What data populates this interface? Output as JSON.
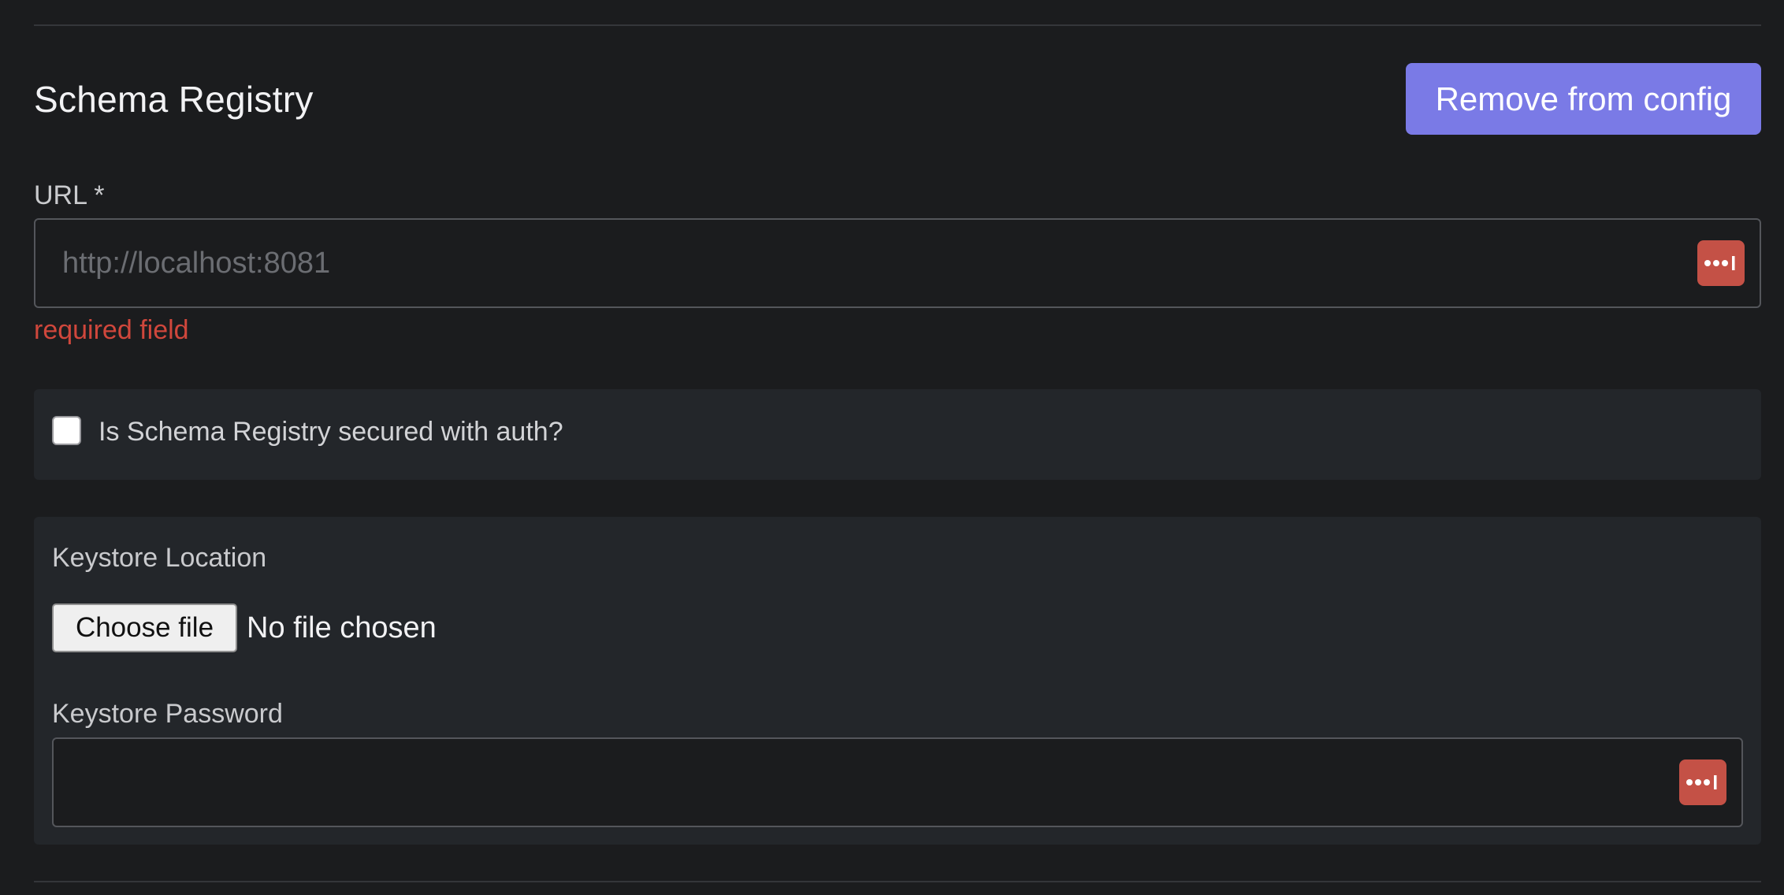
{
  "section": {
    "title": "Schema Registry",
    "remove_button_label": "Remove from config"
  },
  "url_field": {
    "label": "URL *",
    "value": "",
    "placeholder": "http://localhost:8081",
    "error": "required field",
    "icon": "password-manager-icon"
  },
  "auth": {
    "checkbox_label": "Is Schema Registry secured with auth?",
    "checked": false
  },
  "keystore": {
    "location_label": "Keystore Location",
    "choose_file_label": "Choose file",
    "file_status": "No file chosen",
    "password_label": "Keystore Password",
    "password_value": "",
    "password_icon": "password-manager-icon"
  },
  "colors": {
    "background": "#1b1c1e",
    "panel": "#23262a",
    "accent": "#7a7ae6",
    "error": "#d0473c",
    "password_manager_badge": "#c45146"
  }
}
